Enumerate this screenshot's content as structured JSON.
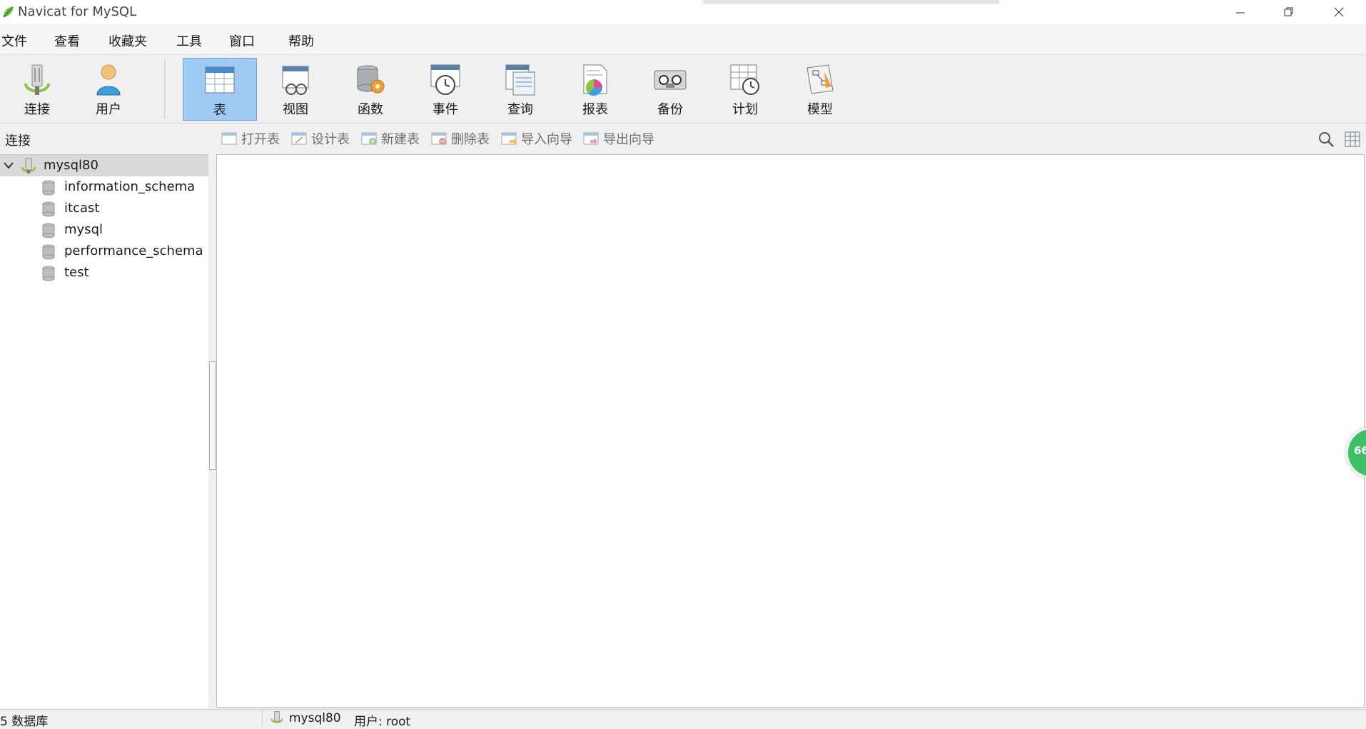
{
  "window": {
    "title": "Navicat for MySQL"
  },
  "menu": [
    "文件",
    "查看",
    "收藏夹",
    "工具",
    "窗口",
    "帮助"
  ],
  "toolbar": {
    "connect": "连接",
    "user": "用户",
    "table": "表",
    "view": "视图",
    "function": "函数",
    "event": "事件",
    "query": "查询",
    "report": "报表",
    "backup": "备份",
    "schedule": "计划",
    "model": "模型"
  },
  "subtoolbar": {
    "connections_label": "连接",
    "open_table": "打开表",
    "design_table": "设计表",
    "new_table": "新建表",
    "delete_table": "删除表",
    "import_wizard": "导入向导",
    "export_wizard": "导出向导"
  },
  "tree": {
    "connection": "mysql80",
    "databases": [
      "information_schema",
      "itcast",
      "mysql",
      "performance_schema",
      "test"
    ]
  },
  "status": {
    "db_count": "5 数据库",
    "connection": "mysql80",
    "user": "用户: root"
  },
  "badge": {
    "value": "66"
  },
  "colors": {
    "active_tool": "#9fcaf4",
    "badge": "#3fbf64"
  }
}
